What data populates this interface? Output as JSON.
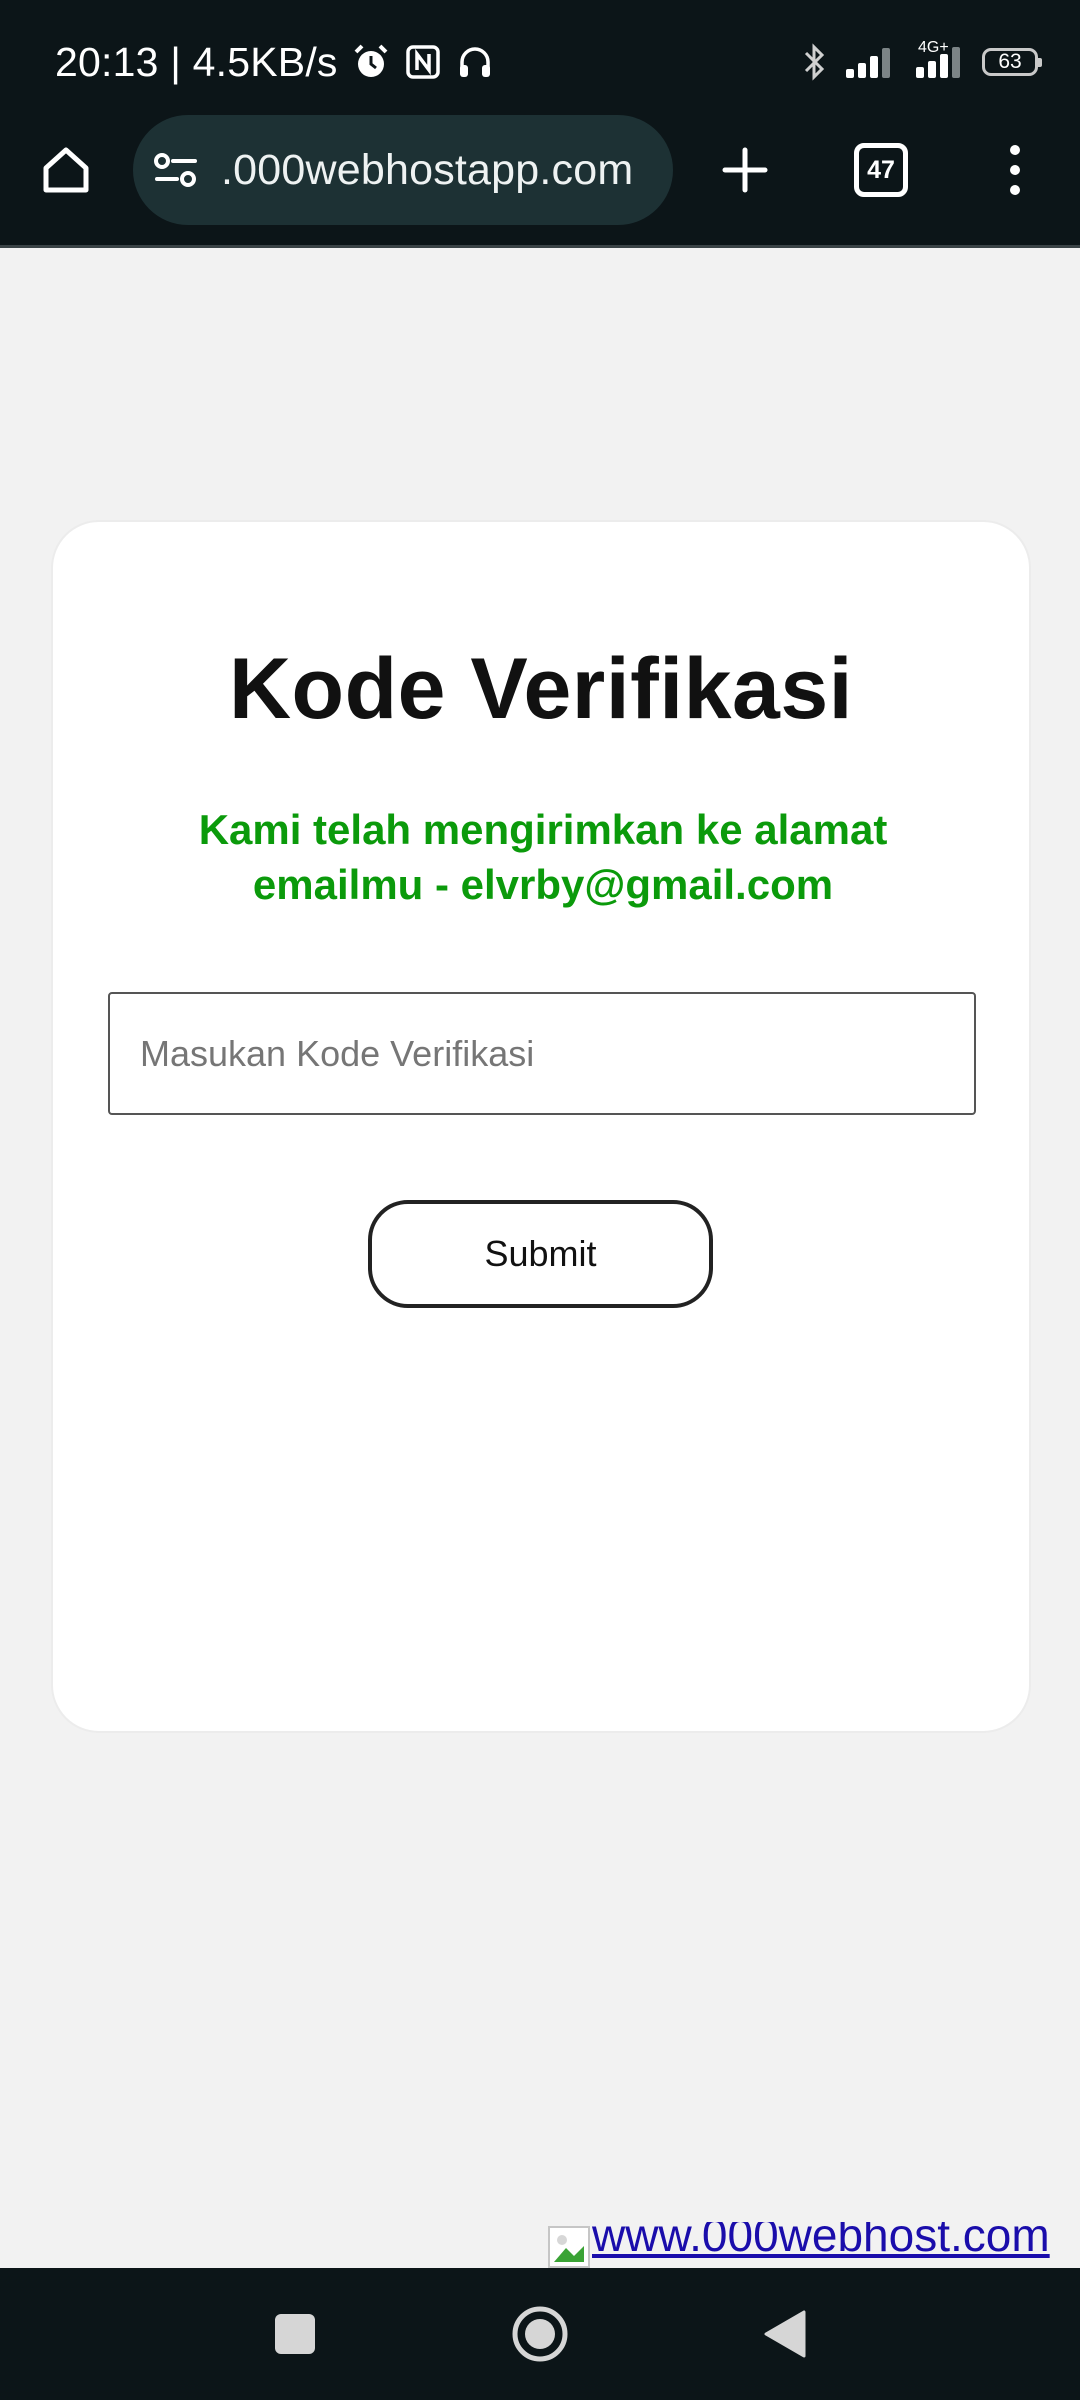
{
  "status_bar": {
    "time_speed": "20:13 | 4.5KB/s",
    "network_type": "4G+",
    "battery_level": "63",
    "icons": [
      "alarm-icon",
      "nfc-icon",
      "headphones-icon",
      "bluetooth-icon",
      "signal-icon",
      "battery-icon"
    ]
  },
  "browser": {
    "url": ".000webhostapp.com",
    "tab_count": "47",
    "icons": [
      "home-icon",
      "site-settings-icon",
      "new-tab-icon",
      "tabs-icon",
      "menu-icon"
    ]
  },
  "card": {
    "title": "Kode Verifikasi",
    "subtitle": "Kami telah mengirimkan ke alamat emailmu - elvrby@gmail.com",
    "input_placeholder": "Masukan Kode Verifikasi",
    "input_value": "",
    "submit_label": "Submit"
  },
  "footer": {
    "host_link": "www.000webhost.com"
  },
  "colors": {
    "subtitle_green": "#0b9a0b",
    "chrome_dark": "#0c1518",
    "url_pill": "#1d3134",
    "page_background": "#f2f2f2"
  },
  "nav_bar": {
    "icons": [
      "recents-icon",
      "home-circle-icon",
      "back-icon"
    ]
  }
}
